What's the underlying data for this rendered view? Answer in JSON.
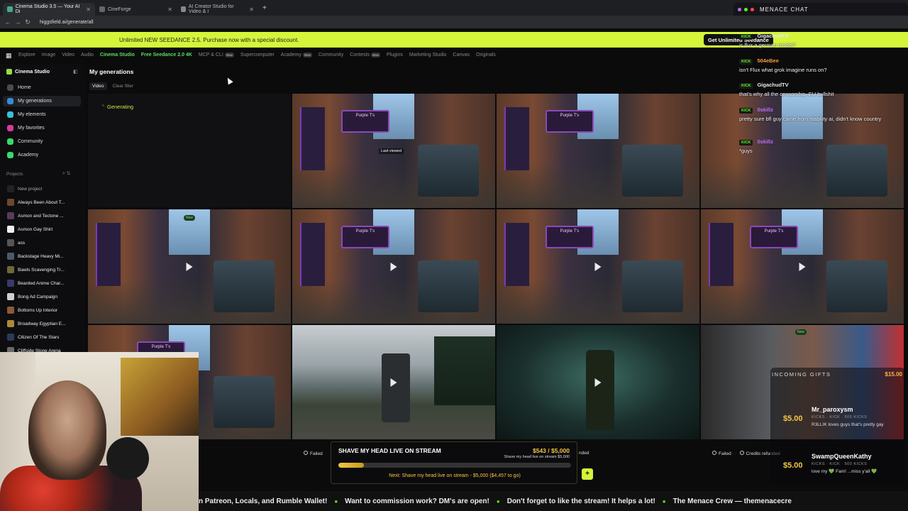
{
  "browser": {
    "tabs": [
      {
        "label": "Cinema Studio 3.5 — Your AI Di",
        "active": true
      },
      {
        "label": "CineForge",
        "active": false
      },
      {
        "label": "AI Creator Studio for Video & I",
        "active": false
      }
    ],
    "url": "higgsfield.ai/generate/all",
    "new_tab": "+"
  },
  "promo": {
    "text": "Unlimited NEW SEEDANCE 2.5. Purchase now with a special discount.",
    "button": "Get Unlimited Seedance"
  },
  "topnav": {
    "items": [
      {
        "label": "Explore",
        "style": "dim"
      },
      {
        "label": "Image",
        "style": "dim"
      },
      {
        "label": "Video",
        "style": "dim"
      },
      {
        "label": "Audio",
        "style": "dim"
      },
      {
        "label": "Cinema Studio",
        "style": "green"
      },
      {
        "label": "Free Seedance 2.0 4K",
        "style": "green"
      },
      {
        "label": "MCP & CLI",
        "style": "dim",
        "badge": "New"
      },
      {
        "label": "Supercomputer",
        "style": "dim"
      },
      {
        "label": "Academy",
        "style": "dim",
        "badge": "New"
      },
      {
        "label": "Community",
        "style": "dim"
      },
      {
        "label": "Contests",
        "style": "dim",
        "badge": "New"
      },
      {
        "label": "Plugins",
        "style": "dim"
      },
      {
        "label": "Marketing Studio",
        "style": "dim"
      },
      {
        "label": "Canvas",
        "style": "dim"
      },
      {
        "label": "Originals",
        "style": "dim"
      }
    ]
  },
  "sidebar": {
    "header": "Cinema Studio",
    "items": [
      {
        "label": "Home",
        "color": "#4a4a52",
        "selected": false
      },
      {
        "label": "My generations",
        "color": "#3a8ad8",
        "selected": true
      },
      {
        "label": "My elements",
        "color": "#3ac0d8",
        "selected": false
      },
      {
        "label": "My favorites",
        "color": "#d83a9a",
        "selected": false
      },
      {
        "label": "Community",
        "color": "#3ad86a",
        "selected": false
      },
      {
        "label": "Academy",
        "color": "#3ad86a",
        "selected": false
      }
    ],
    "projects_label": "Projects",
    "new_project": "New project",
    "projects": [
      {
        "label": "Always Been About T...",
        "color": "#6a4a2a"
      },
      {
        "label": "Asmon and Tectone ...",
        "color": "#5a3a5a"
      },
      {
        "label": "Asmon Gay Shirt",
        "color": "#eeeeee"
      },
      {
        "label": "ass",
        "color": "#555555"
      },
      {
        "label": "Backstage Heavy Mi...",
        "color": "#4a5a6a"
      },
      {
        "label": "Bawls Scavenging Tr...",
        "color": "#6a6a3a"
      },
      {
        "label": "Bearded Anime Char...",
        "color": "#3a3a6a"
      },
      {
        "label": "Bong Ad Campaign",
        "color": "#d0d0d0"
      },
      {
        "label": "Bottoms Up Interior",
        "color": "#8a5a3a"
      },
      {
        "label": "Broadway Egyptian E...",
        "color": "#aa8a3a"
      },
      {
        "label": "Citizen Of The Stars",
        "color": "#2a3a5a"
      },
      {
        "label": "Cliffside Stone Arena",
        "color": "#6a6a6a"
      }
    ]
  },
  "main": {
    "title": "My generations",
    "filter_chip": "Video",
    "clear_filter": "Clear filter",
    "generating": "Generating",
    "last_viewed": "Last viewed",
    "sign_text": "Purple T's",
    "tile_new": "New",
    "failed": "Failed",
    "credits_refunded": "Credits refunded",
    "refunded_partial": "nded"
  },
  "chat": {
    "title": "MENACE CHAT",
    "platform": "KICK",
    "messages": [
      {
        "user": "GigachudTV",
        "color": "#e8e8e8",
        "text": "is flux a german model?"
      },
      {
        "user": "504eBee",
        "color": "#ff9a3c",
        "text": "isn't Flux what grok imagine runs on?"
      },
      {
        "user": "GigachudTV",
        "color": "#e8e8e8",
        "text": "that's why all the censorship, EU bullshit"
      },
      {
        "user": "0skillz",
        "color": "#b86cff",
        "text": "pretty sure bfl guy came from stability ai, didn't know country"
      },
      {
        "user": "0skillz",
        "color": "#b86cff",
        "text": "*guys"
      }
    ]
  },
  "gifts": {
    "title": "INCOMING GIFTS",
    "total": "$15.00",
    "items": [
      {
        "amount": "$5.00",
        "user": "Mr_paroxysm",
        "meta": "KICKS · KICK · 500 KICKS",
        "note": "R3LLIK loves guys that's pretty gay"
      },
      {
        "amount": "$5.00",
        "user": "SwampQueenKathy",
        "meta": "KICKS · KICK · 500 KICKS",
        "note": "love my 💚 Fam! ...miss y'all 💚"
      }
    ]
  },
  "goal": {
    "title": "SHAVE MY HEAD LIVE ON STREAM",
    "amount": "$543 / $5,000",
    "sub": "Shave my head live on stream $5,000",
    "progress": 0.109,
    "next": "Next: Shave my head live on stream - $5,000 ($4,457 to go)"
  },
  "ticker": [
    "n Patreon, Locals, and Rumble Wallet!",
    "Want to commission work? DM's are open!",
    "Don't forget to like the stream! It helps a lot!",
    "The Menace Crew — themenacecre"
  ]
}
